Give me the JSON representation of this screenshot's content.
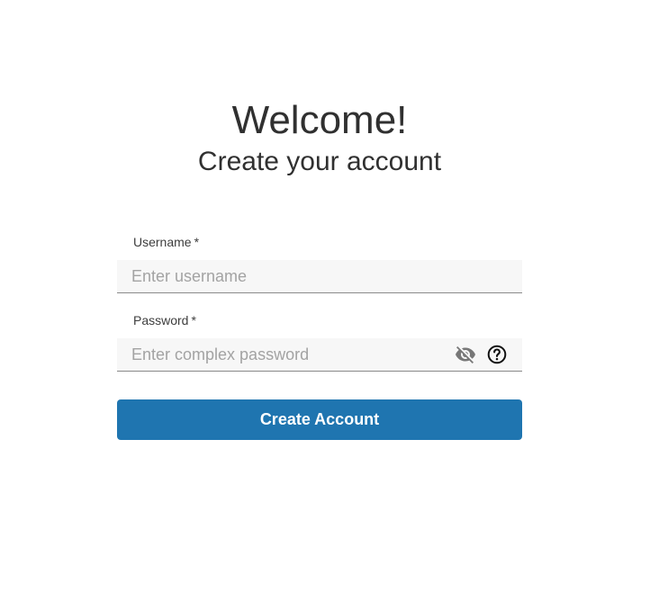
{
  "header": {
    "title": "Welcome!",
    "subtitle": "Create your account"
  },
  "form": {
    "username": {
      "label": "Username",
      "required_mark": "*",
      "value": "",
      "placeholder": "Enter username"
    },
    "password": {
      "label": "Password",
      "required_mark": "*",
      "value": "",
      "placeholder": "Enter complex password",
      "visibility_icon": "eye-off-icon",
      "help_icon": "help-circle-icon"
    },
    "submit_label": "Create Account"
  },
  "colors": {
    "primary_button": "#1f75b0",
    "input_background": "#f7f7f7",
    "input_border": "#8a8a8a",
    "placeholder_text": "#a3a3a3"
  }
}
